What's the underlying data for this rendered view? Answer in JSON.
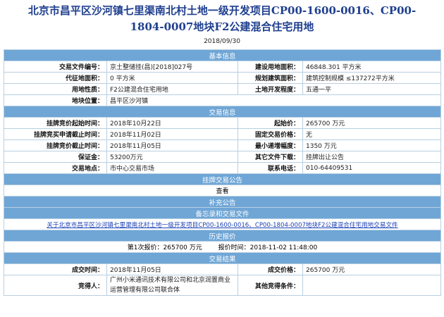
{
  "page": {
    "title_line1": "北京市昌平区沙河镇七里渠南北村土地一级开发项目CP00-1600-0016、CP00-",
    "title_line2": "1804-0007地块F2公建混合住宅用地",
    "date": "2018/09/30"
  },
  "basic": {
    "header": "基本信息",
    "doc_no_label": "交易文件编号：",
    "doc_no_value": "京土整储挂(昌)[2018]027号",
    "land_area_label": "建设用地面积：",
    "land_area_value": "46848.301 平方米",
    "zhengdi_label": "代征地面积：",
    "zhengdi_value": "0 平方米",
    "plan_area_label": "规划建筑面积：",
    "plan_area_value": "建筑控制规模 ≤137272平方米",
    "use_label": "用地性质：",
    "use_value": "F2公建混合住宅用地",
    "dev_label": "土地开发程度：",
    "dev_value": "五通一平",
    "loc_label": "地块位置：",
    "loc_value": "昌平区沙河镇"
  },
  "trade": {
    "header": "交易信息",
    "start_label": "挂牌竞价起始时间：",
    "start_value": "2018年10月22日",
    "start_price_label": "起始价：",
    "start_price_value": "265700 万元",
    "apply_end_label": "挂牌竞买申请截止时间：",
    "apply_end_value": "2018年11月02日",
    "fixed_price_label": "固定交易价格：",
    "fixed_price_value": "无",
    "bid_end_label": "挂牌竞价截止时间：",
    "bid_end_value": "2018年11月05日",
    "min_inc_label": "最小递增幅度：",
    "min_inc_value": "1350 万元",
    "deposit_label": "保证金：",
    "deposit_value": "53200万元",
    "other_doc_label": "其它文件下载：",
    "other_doc_value": "挂牌出让公告",
    "place_label": "交易地点：",
    "place_value": "市中心交易市场",
    "phone_label": "联系电话：",
    "phone_value": "010-64409531"
  },
  "notice": {
    "header": "挂牌交易公告",
    "view_label": "查看"
  },
  "supplement": {
    "header": "补充公告"
  },
  "record": {
    "header": "备忘录和交易文件",
    "link_text": "关于北京市昌平区沙河镇七里渠南北村土地一级开发项目CP00-1600-0016、CP00-1804-0007地块F2公建混合住宅用地交易文件"
  },
  "history": {
    "header": "历史报价",
    "entry": "第1次报价：265700 万元        报价时间：2018-11-02 11:48:00"
  },
  "result": {
    "header": "交易结果",
    "time_label": "成交时间：",
    "time_value": "2018年11月05日",
    "price_label": "成交价格：",
    "price_value": "265700 万元",
    "bidder_label": "竞得人：",
    "bidder_value": "广州小米通讯技术有限公司和北京润置商业运营管理有限公司联合体",
    "other_label": "其他竞得条件：",
    "other_value": ""
  },
  "colors": {
    "section_bg": "#6fa6d6",
    "title": "#1f3f8f",
    "border": "#b9cfe0",
    "link": "#1a3fb5"
  }
}
